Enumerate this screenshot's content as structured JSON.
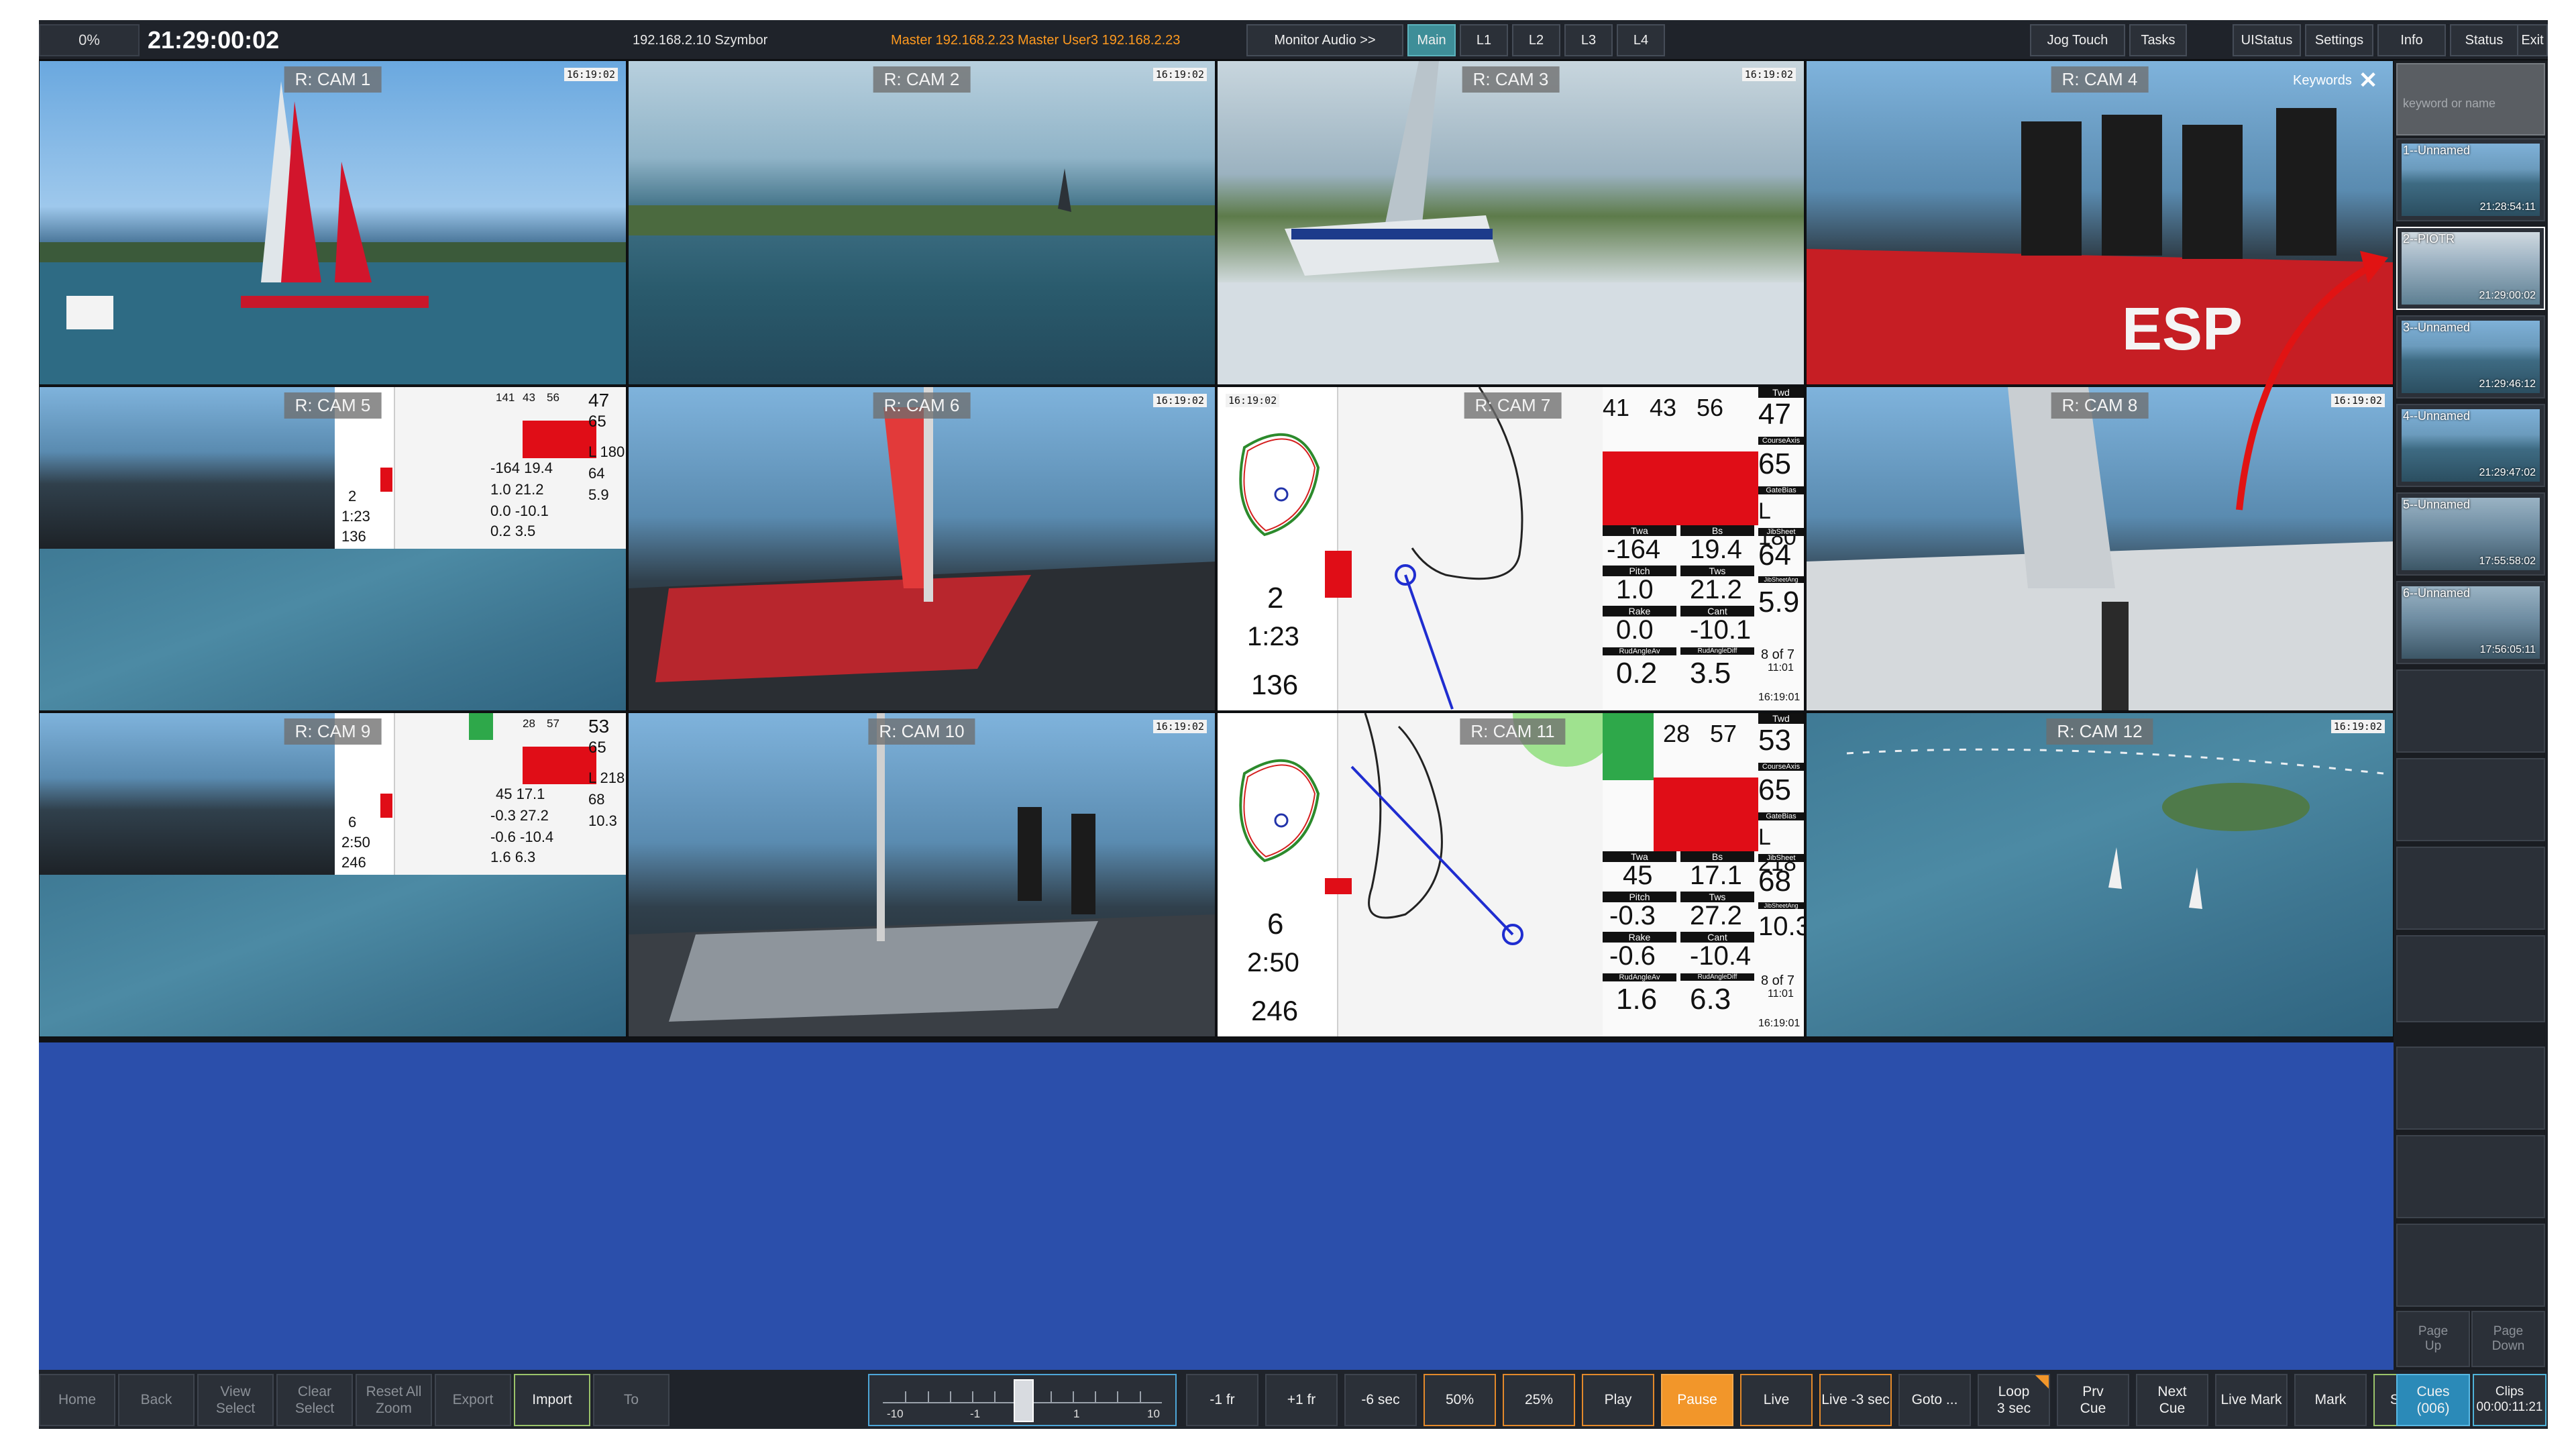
{
  "topbar": {
    "percent": "0%",
    "clock": "21:29:00:02",
    "ip": "192.168.2.10 Szymbor",
    "master": "Master 192.168.2.23   Master   User3   192.168.2.23",
    "buttons": {
      "monitor_audio": "Monitor Audio >>",
      "main": "Main",
      "l1": "L1",
      "l2": "L2",
      "l3": "L3",
      "l4": "L4",
      "jog_touch": "Jog Touch",
      "tasks": "Tasks",
      "uistatus": "UIStatus",
      "settings": "Settings",
      "info": "Info",
      "status": "Status",
      "exit": "Exit"
    }
  },
  "cams": [
    {
      "label": "R: CAM 1",
      "tc": "16:19:02"
    },
    {
      "label": "R: CAM 2",
      "tc": "16:19:02"
    },
    {
      "label": "R: CAM 3",
      "tc": "16:19:02"
    },
    {
      "label": "R: CAM 4",
      "tc": ""
    },
    {
      "label": "R: CAM 5",
      "tc": ""
    },
    {
      "label": "R: CAM 6",
      "tc": "16:19:02"
    },
    {
      "label": "R: CAM 7",
      "tc": "16:19:02"
    },
    {
      "label": "R: CAM 8",
      "tc": "16:19:02"
    },
    {
      "label": "R: CAM 9",
      "tc": ""
    },
    {
      "label": "R: CAM 10",
      "tc": "16:19:02"
    },
    {
      "label": "R: CAM 11",
      "tc": "16:19:02"
    },
    {
      "label": "R: CAM 12",
      "tc": "16:19:02"
    }
  ],
  "telemetry_full": {
    "cam7": {
      "top_nums": [
        "41",
        "43",
        "56"
      ],
      "twd": "47",
      "course_axis": "65",
      "gate_bias": "L 180",
      "jib_sheet": "64",
      "twa": "-164",
      "bs": "19.4",
      "pitch": "1.0",
      "tws": "21.2",
      "jib_sheet_ang": "5.9",
      "rake": "0.0",
      "cant": "-10.1",
      "rud_angle_av": "0.2",
      "rud_angle_diff": "3.5",
      "leg": "8 of 7",
      "time_small": "11:01",
      "clock_small": "16:19:01",
      "left_nums": [
        "2",
        "1:23",
        "136"
      ]
    },
    "cam11": {
      "top_nums": [
        "28",
        "57"
      ],
      "twd": "53",
      "course_axis": "65",
      "gate_bias": "L 218",
      "jib_sheet": "68",
      "twa": "45",
      "bs": "17.1",
      "pitch": "-0.3",
      "tws": "27.2",
      "jib_sheet_ang": "10.3",
      "rake": "-0.6",
      "cant": "-10.4",
      "rud_angle_av": "1.6",
      "rud_angle_diff": "6.3",
      "leg": "8 of 7",
      "time_small": "11:01",
      "clock_small": "16:19:01",
      "left_nums": [
        "6",
        "2:50",
        "246"
      ]
    }
  },
  "telemetry_labels": {
    "twd": "Twd",
    "course_axis": "CourseAxis",
    "gate_bias": "GateBias",
    "jib_sheet": "JibSheet",
    "twa": "Twa",
    "bs": "Bs",
    "pitch": "Pitch",
    "tws": "Tws",
    "jib_sheet_ang": "JibSheetAng",
    "rake": "Rake",
    "cant": "Cant",
    "rud_angle_av": "RudAngleAv",
    "rud_angle_diff": "RudAngleDiff"
  },
  "telemetry_mini": {
    "cam5": {
      "top": [
        "141",
        "43",
        "56",
        "47"
      ],
      "rows": [
        "65",
        "-164  19.4",
        "L 180",
        "1.0  21.2",
        "64",
        "0.0  -10.1",
        "5.9",
        "0.2  3.5"
      ],
      "left": [
        "2",
        "1:23",
        "136"
      ]
    },
    "cam9": {
      "top": [
        "28",
        "57",
        "53"
      ],
      "rows": [
        "65",
        "45  17.1",
        "L 218",
        "-0.3  27.2",
        "68",
        "-0.6  -10.4",
        "10.3",
        "1.6  6.3"
      ],
      "left": [
        "6",
        "2:50",
        "246"
      ]
    }
  },
  "side": {
    "keywords_label": "Keywords",
    "close": "✕",
    "placeholder": "keyword or name",
    "thumbs": [
      {
        "name": "1--Unnamed",
        "time": "21:28:54:11"
      },
      {
        "name": "2--PIOTR",
        "time": "21:29:00:02"
      },
      {
        "name": "3--Unnamed",
        "time": "21:29:46:12"
      },
      {
        "name": "4--Unnamed",
        "time": "21:29:47:02"
      },
      {
        "name": "5--Unnamed",
        "time": "17:55:58:02"
      },
      {
        "name": "6--Unnamed",
        "time": "17:56:05:11"
      }
    ],
    "page_up": "Page\nUp",
    "page_down": "Page\nDown"
  },
  "bottom": {
    "home": "Home",
    "back": "Back",
    "view_select": "View\nSelect",
    "clear_select": "Clear\nSelect",
    "reset_zoom": "Reset All\nZoom",
    "export": "Export",
    "import": "Import",
    "to": "To",
    "jog_labels": [
      "-10",
      "-1",
      "1",
      "10"
    ],
    "minus_1fr": "-1 fr",
    "plus_1fr": "+1 fr",
    "minus_6sec": "-6 sec",
    "p50": "50%",
    "p25": "25%",
    "play": "Play",
    "pause": "Pause",
    "live": "Live",
    "live_minus_3": "Live -3 sec",
    "goto": "Goto ...",
    "loop": "Loop\n3 sec",
    "prv_cue": "Prv\nCue",
    "next_cue": "Next\nCue",
    "live_mark": "Live Mark",
    "mark": "Mark",
    "select": "Select",
    "cues": "Cues\n(006)",
    "clips": "Clips\n00:00:11:21"
  },
  "colors": {
    "accent_cyan": "#3e8e98",
    "blue_area": "#2b4fab",
    "pause_orange": "#f2962a",
    "telemetry_red": "#e00d17",
    "annotation_red": "#e11313"
  }
}
